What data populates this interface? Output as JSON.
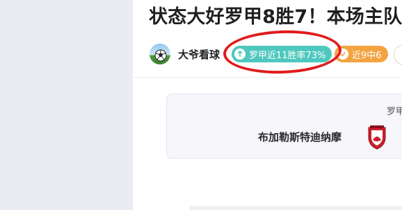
{
  "article": {
    "title": "状态大好罗甲8胜7！本场主队"
  },
  "author": {
    "name": "大爷看球",
    "avatar_icon": "soccer-ball-avatar"
  },
  "badges": [
    {
      "label": "罗甲近11胜率73%",
      "icon": "arrow-up-icon",
      "color": "#4ec8be"
    },
    {
      "label": "近9中6",
      "icon": "check-icon",
      "color": "#f4a341"
    }
  ],
  "annotation": {
    "color": "#e01b1b"
  },
  "match_card": {
    "league_prefix": "罗甲",
    "home_team": "布加勒斯特迪纳摩",
    "home_crest_icon": "dinamo-crest-icon"
  }
}
